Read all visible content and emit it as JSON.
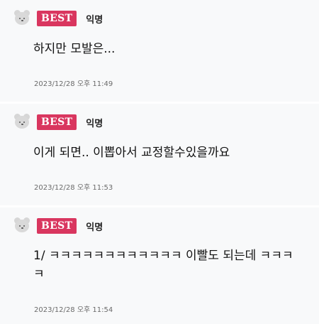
{
  "comments": [
    {
      "badge": "BEST",
      "author": "익명",
      "text": "하지만 모발은...",
      "time": "2023/12/28 오후 11:49"
    },
    {
      "badge": "BEST",
      "author": "익명",
      "text": "이게 되면.. 이뽑아서 교정할수있을까요",
      "time": "2023/12/28 오후 11:53"
    },
    {
      "badge": "BEST",
      "author": "익명",
      "text": "1/ ㅋㅋㅋㅋㅋㅋㅋㅋㅋㅋㅋㅋ 이빨도 되는데 ㅋㅋㅋㅋ",
      "time": "2023/12/28 오후 11:54"
    }
  ],
  "colors": {
    "badge_bg": "#d9365f",
    "card_bg": "#f8f9fa"
  },
  "icons": {
    "avatar": "bear-avatar-icon"
  }
}
